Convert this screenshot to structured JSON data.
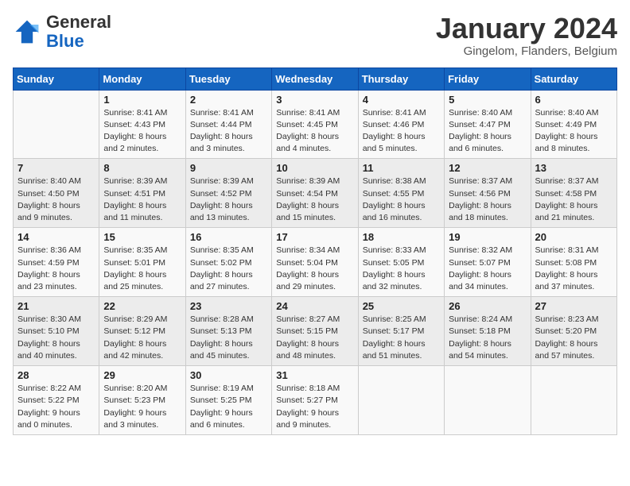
{
  "header": {
    "logo_general": "General",
    "logo_blue": "Blue",
    "month_title": "January 2024",
    "location": "Gingelom, Flanders, Belgium"
  },
  "days_of_week": [
    "Sunday",
    "Monday",
    "Tuesday",
    "Wednesday",
    "Thursday",
    "Friday",
    "Saturday"
  ],
  "weeks": [
    [
      {
        "num": "",
        "sunrise": "",
        "sunset": "",
        "daylight": ""
      },
      {
        "num": "1",
        "sunrise": "Sunrise: 8:41 AM",
        "sunset": "Sunset: 4:43 PM",
        "daylight": "Daylight: 8 hours and 2 minutes."
      },
      {
        "num": "2",
        "sunrise": "Sunrise: 8:41 AM",
        "sunset": "Sunset: 4:44 PM",
        "daylight": "Daylight: 8 hours and 3 minutes."
      },
      {
        "num": "3",
        "sunrise": "Sunrise: 8:41 AM",
        "sunset": "Sunset: 4:45 PM",
        "daylight": "Daylight: 8 hours and 4 minutes."
      },
      {
        "num": "4",
        "sunrise": "Sunrise: 8:41 AM",
        "sunset": "Sunset: 4:46 PM",
        "daylight": "Daylight: 8 hours and 5 minutes."
      },
      {
        "num": "5",
        "sunrise": "Sunrise: 8:40 AM",
        "sunset": "Sunset: 4:47 PM",
        "daylight": "Daylight: 8 hours and 6 minutes."
      },
      {
        "num": "6",
        "sunrise": "Sunrise: 8:40 AM",
        "sunset": "Sunset: 4:49 PM",
        "daylight": "Daylight: 8 hours and 8 minutes."
      }
    ],
    [
      {
        "num": "7",
        "sunrise": "Sunrise: 8:40 AM",
        "sunset": "Sunset: 4:50 PM",
        "daylight": "Daylight: 8 hours and 9 minutes."
      },
      {
        "num": "8",
        "sunrise": "Sunrise: 8:39 AM",
        "sunset": "Sunset: 4:51 PM",
        "daylight": "Daylight: 8 hours and 11 minutes."
      },
      {
        "num": "9",
        "sunrise": "Sunrise: 8:39 AM",
        "sunset": "Sunset: 4:52 PM",
        "daylight": "Daylight: 8 hours and 13 minutes."
      },
      {
        "num": "10",
        "sunrise": "Sunrise: 8:39 AM",
        "sunset": "Sunset: 4:54 PM",
        "daylight": "Daylight: 8 hours and 15 minutes."
      },
      {
        "num": "11",
        "sunrise": "Sunrise: 8:38 AM",
        "sunset": "Sunset: 4:55 PM",
        "daylight": "Daylight: 8 hours and 16 minutes."
      },
      {
        "num": "12",
        "sunrise": "Sunrise: 8:37 AM",
        "sunset": "Sunset: 4:56 PM",
        "daylight": "Daylight: 8 hours and 18 minutes."
      },
      {
        "num": "13",
        "sunrise": "Sunrise: 8:37 AM",
        "sunset": "Sunset: 4:58 PM",
        "daylight": "Daylight: 8 hours and 21 minutes."
      }
    ],
    [
      {
        "num": "14",
        "sunrise": "Sunrise: 8:36 AM",
        "sunset": "Sunset: 4:59 PM",
        "daylight": "Daylight: 8 hours and 23 minutes."
      },
      {
        "num": "15",
        "sunrise": "Sunrise: 8:35 AM",
        "sunset": "Sunset: 5:01 PM",
        "daylight": "Daylight: 8 hours and 25 minutes."
      },
      {
        "num": "16",
        "sunrise": "Sunrise: 8:35 AM",
        "sunset": "Sunset: 5:02 PM",
        "daylight": "Daylight: 8 hours and 27 minutes."
      },
      {
        "num": "17",
        "sunrise": "Sunrise: 8:34 AM",
        "sunset": "Sunset: 5:04 PM",
        "daylight": "Daylight: 8 hours and 29 minutes."
      },
      {
        "num": "18",
        "sunrise": "Sunrise: 8:33 AM",
        "sunset": "Sunset: 5:05 PM",
        "daylight": "Daylight: 8 hours and 32 minutes."
      },
      {
        "num": "19",
        "sunrise": "Sunrise: 8:32 AM",
        "sunset": "Sunset: 5:07 PM",
        "daylight": "Daylight: 8 hours and 34 minutes."
      },
      {
        "num": "20",
        "sunrise": "Sunrise: 8:31 AM",
        "sunset": "Sunset: 5:08 PM",
        "daylight": "Daylight: 8 hours and 37 minutes."
      }
    ],
    [
      {
        "num": "21",
        "sunrise": "Sunrise: 8:30 AM",
        "sunset": "Sunset: 5:10 PM",
        "daylight": "Daylight: 8 hours and 40 minutes."
      },
      {
        "num": "22",
        "sunrise": "Sunrise: 8:29 AM",
        "sunset": "Sunset: 5:12 PM",
        "daylight": "Daylight: 8 hours and 42 minutes."
      },
      {
        "num": "23",
        "sunrise": "Sunrise: 8:28 AM",
        "sunset": "Sunset: 5:13 PM",
        "daylight": "Daylight: 8 hours and 45 minutes."
      },
      {
        "num": "24",
        "sunrise": "Sunrise: 8:27 AM",
        "sunset": "Sunset: 5:15 PM",
        "daylight": "Daylight: 8 hours and 48 minutes."
      },
      {
        "num": "25",
        "sunrise": "Sunrise: 8:25 AM",
        "sunset": "Sunset: 5:17 PM",
        "daylight": "Daylight: 8 hours and 51 minutes."
      },
      {
        "num": "26",
        "sunrise": "Sunrise: 8:24 AM",
        "sunset": "Sunset: 5:18 PM",
        "daylight": "Daylight: 8 hours and 54 minutes."
      },
      {
        "num": "27",
        "sunrise": "Sunrise: 8:23 AM",
        "sunset": "Sunset: 5:20 PM",
        "daylight": "Daylight: 8 hours and 57 minutes."
      }
    ],
    [
      {
        "num": "28",
        "sunrise": "Sunrise: 8:22 AM",
        "sunset": "Sunset: 5:22 PM",
        "daylight": "Daylight: 9 hours and 0 minutes."
      },
      {
        "num": "29",
        "sunrise": "Sunrise: 8:20 AM",
        "sunset": "Sunset: 5:23 PM",
        "daylight": "Daylight: 9 hours and 3 minutes."
      },
      {
        "num": "30",
        "sunrise": "Sunrise: 8:19 AM",
        "sunset": "Sunset: 5:25 PM",
        "daylight": "Daylight: 9 hours and 6 minutes."
      },
      {
        "num": "31",
        "sunrise": "Sunrise: 8:18 AM",
        "sunset": "Sunset: 5:27 PM",
        "daylight": "Daylight: 9 hours and 9 minutes."
      },
      {
        "num": "",
        "sunrise": "",
        "sunset": "",
        "daylight": ""
      },
      {
        "num": "",
        "sunrise": "",
        "sunset": "",
        "daylight": ""
      },
      {
        "num": "",
        "sunrise": "",
        "sunset": "",
        "daylight": ""
      }
    ]
  ]
}
